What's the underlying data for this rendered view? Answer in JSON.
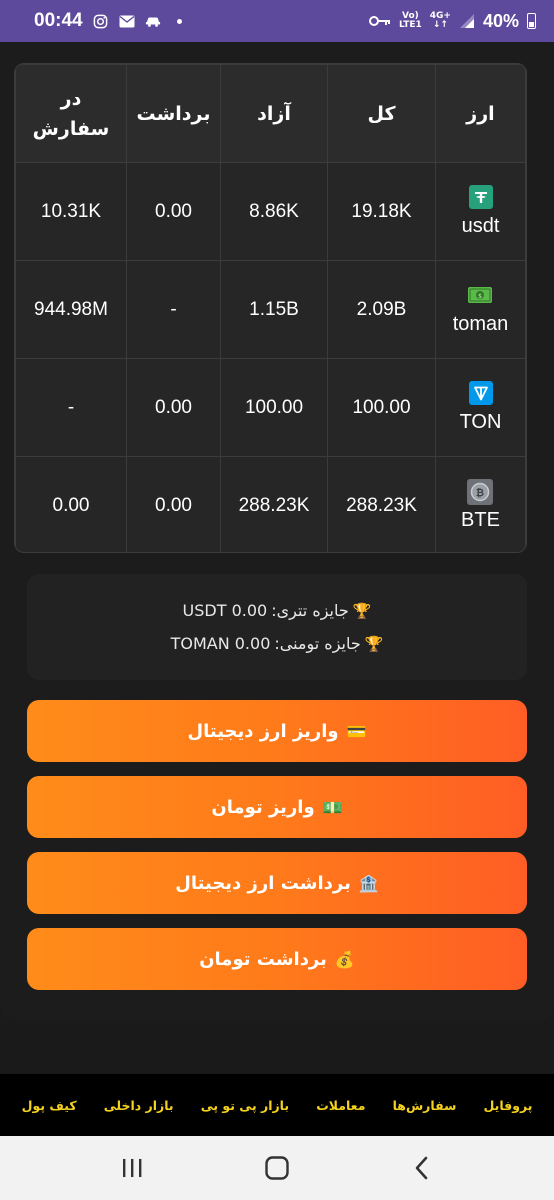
{
  "status_bar": {
    "time": "00:44",
    "network_top": "Vo)",
    "network_bottom": "LTE1",
    "network_type": "4G+",
    "battery": "40%"
  },
  "table": {
    "headers": {
      "currency": "ارز",
      "total": "کل",
      "free": "آزاد",
      "withdrawal": "برداشت",
      "in_order": "در سفارش"
    },
    "rows": [
      {
        "name": "usdt",
        "icon": "tether-icon",
        "total": "19.18K",
        "free": "8.86K",
        "withdrawal": "0.00",
        "in_order": "10.31K"
      },
      {
        "name": "toman",
        "icon": "money-icon",
        "total": "2.09B",
        "free": "1.15B",
        "withdrawal": "-",
        "in_order": "944.98M"
      },
      {
        "name": "TON",
        "icon": "ton-icon",
        "total": "100.00",
        "free": "100.00",
        "withdrawal": "0.00",
        "in_order": "-"
      },
      {
        "name": "BTE",
        "icon": "bte-coin-icon",
        "total": "288.23K",
        "free": "288.23K",
        "withdrawal": "0.00",
        "in_order": "0.00"
      }
    ]
  },
  "rewards": {
    "tether_label": "جایزه تتری:",
    "tether_value": "USDT 0.00",
    "toman_label": "جایزه تومنی:",
    "toman_value": "TOMAN 0.00"
  },
  "buttons": {
    "deposit_crypto": "واریز ارز دیجیتال",
    "deposit_toman": "واریز تومان",
    "withdraw_crypto": "برداشت ارز دیجیتال",
    "withdraw_toman": "برداشت تومان"
  },
  "bottom_nav": {
    "profile": "پروفایل",
    "orders": "سفارش‌ها",
    "trades": "معاملات",
    "p2p_market": "بازار پی تو پی",
    "internal_market": "بازار داخلی",
    "wallet": "کیف پول"
  },
  "colors": {
    "status_bar": "#5d4a9c",
    "accent_orange": "#ff7a1a",
    "nav_text": "#f5d21e"
  }
}
